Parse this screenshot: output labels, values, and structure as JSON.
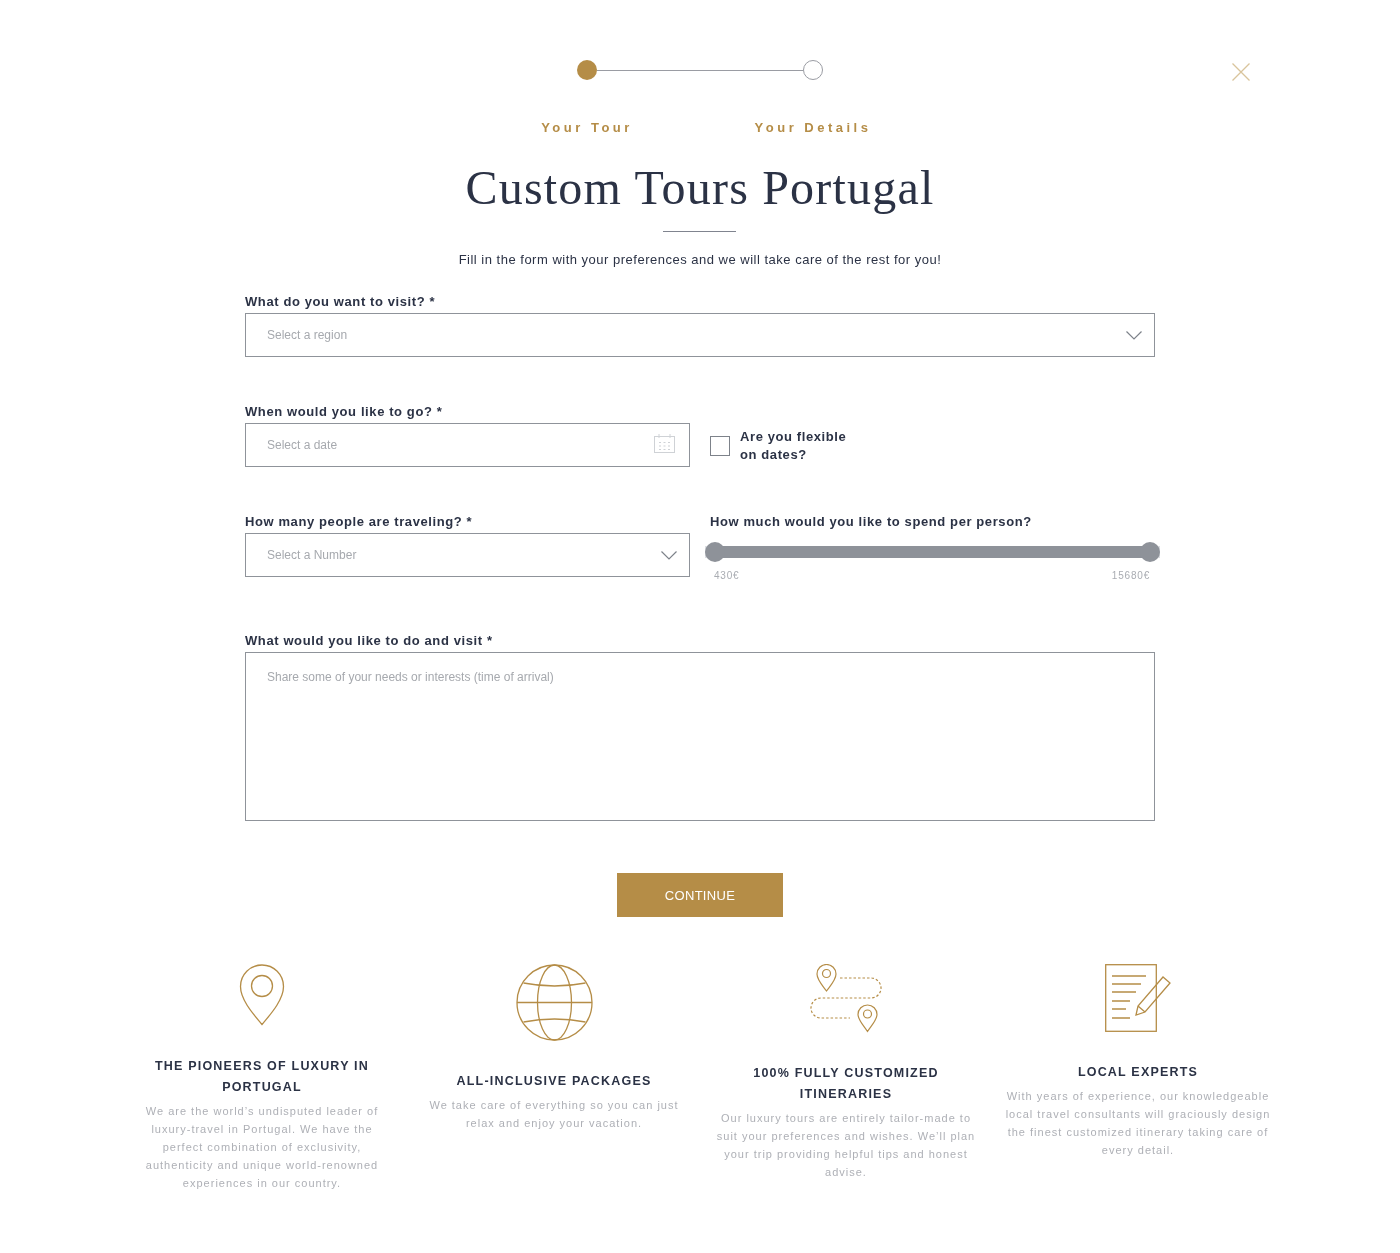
{
  "stepper": {
    "steps": [
      {
        "label": "Your Tour",
        "selected": true
      },
      {
        "label": "Your Details",
        "selected": false
      }
    ]
  },
  "title": "Custom Tours Portugal",
  "subtitle": "Fill in the form with your preferences and we will take care of the rest for you!",
  "form": {
    "rows": [
      {
        "fields": [
          {
            "kind": "select",
            "label": "What do you want to visit? *",
            "placeholder": "Select a region"
          }
        ]
      },
      {
        "fields": [
          {
            "kind": "date",
            "label": "When would you like to go? *",
            "placeholder": "Select a date"
          },
          {
            "kind": "checkbox",
            "label": "Are you flexible on dates?",
            "checked": false
          }
        ]
      },
      {
        "fields": [
          {
            "kind": "select",
            "label": "How many people are traveling? *",
            "placeholder": "Select a Number"
          },
          {
            "kind": "range",
            "label": "How much would you like to spend per person?",
            "thumbs": [
              {
                "level": 0
              },
              {
                "level": 1
              }
            ],
            "min_label": "430€",
            "max_label": "15680€"
          }
        ]
      },
      {
        "fields": [
          {
            "kind": "textarea",
            "label": "What would you like to do and visit *",
            "placeholder": "Share some of your needs or interests (time of arrival)"
          }
        ]
      }
    ]
  },
  "continue_button": {
    "label": "CONTINUE"
  },
  "features": [
    {
      "title": "THE PIONEERS OF LUXURY IN PORTUGAL",
      "text": "We are the world’s undisputed leader of luxury-travel in Portugal. We have the perfect combination of exclusivity, authenticity and unique world-renowned experiences in our country."
    },
    {
      "title": "ALL-INCLUSIVE PACKAGES",
      "text": "We take care of everything so you can just relax and enjoy your vacation."
    },
    {
      "title": "100% FULLY CUSTOMIZED ITINERARIES",
      "text": "Our luxury tours are entirely tailor-made to suit your preferences and wishes. We’ll plan your trip providing helpful tips and honest advise."
    },
    {
      "title": "LOCAL EXPERTS",
      "text": "With years of experience, our knowledgeable local travel consultants will graciously design the finest customized itinerary taking care of every detail."
    }
  ]
}
